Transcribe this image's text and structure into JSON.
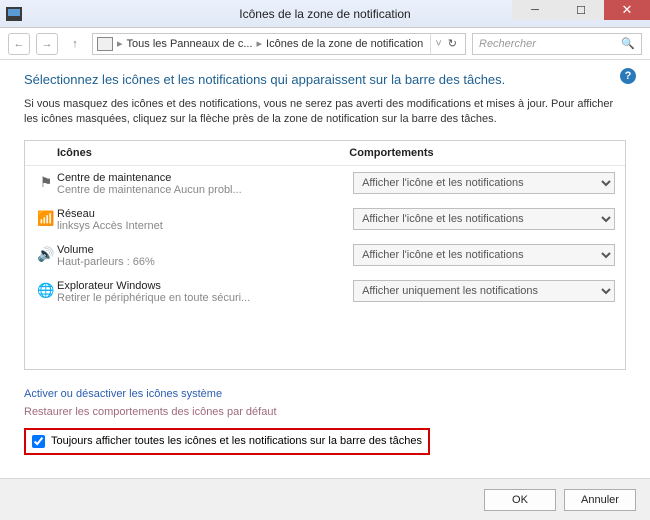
{
  "window": {
    "title": "Icônes de la zone de notification",
    "min_label": "─",
    "max_label": "☐",
    "close_label": "✕"
  },
  "nav": {
    "breadcrumb_root": "Tous les Panneaux de c...",
    "breadcrumb_current": "Icônes de la zone de notification",
    "refresh_glyph": "↻",
    "search_placeholder": "Rechercher",
    "search_glyph": "🔍"
  },
  "page": {
    "help_glyph": "?",
    "heading": "Sélectionnez les icônes et les notifications qui apparaissent sur la barre des tâches.",
    "description": "Si vous masquez des icônes et des notifications, vous ne serez pas averti des modifications et mises à jour. Pour afficher les icônes masquées, cliquez sur la flèche près de la zone de notification sur la barre des tâches.",
    "col_icons": "Icônes",
    "col_behaviors": "Comportements",
    "rows": [
      {
        "glyph": "⚑",
        "name": "Centre de maintenance",
        "sub": "Centre de maintenance  Aucun probl...",
        "behavior": "Afficher l'icône et les notifications"
      },
      {
        "glyph": "📶",
        "name": "Réseau",
        "sub": "linksys Accès Internet",
        "behavior": "Afficher l'icône et les notifications"
      },
      {
        "glyph": "🔊",
        "name": "Volume",
        "sub": "Haut-parleurs : 66%",
        "behavior": "Afficher l'icône et les notifications"
      },
      {
        "glyph": "🌐",
        "name": "Explorateur Windows",
        "sub": "Retirer le périphérique en toute sécuri...",
        "behavior": "Afficher uniquement les notifications"
      }
    ],
    "link_system_icons": "Activer ou désactiver les icônes système",
    "link_restore": "Restaurer les comportements des icônes par défaut",
    "checkbox_label": "Toujours afficher toutes les icônes et les notifications sur la barre des tâches",
    "checkbox_checked": true
  },
  "buttons": {
    "ok": "OK",
    "cancel": "Annuler"
  }
}
